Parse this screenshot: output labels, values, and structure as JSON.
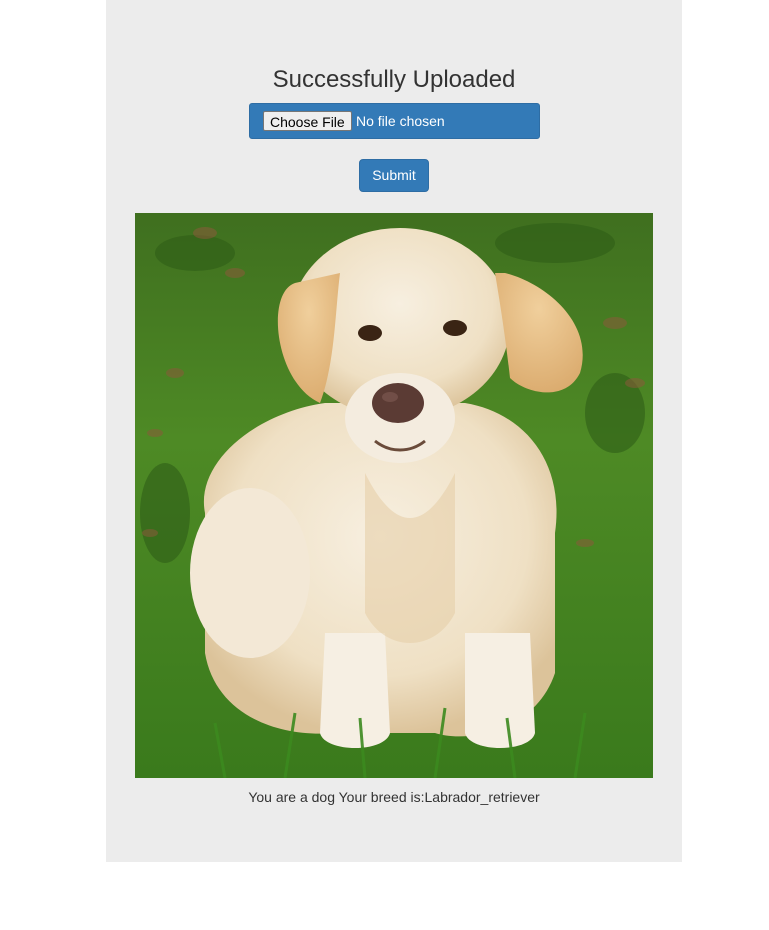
{
  "page": {
    "title": "Successfully Uploaded",
    "upload": {
      "choose_label": "Choose File",
      "status": "No file chosen"
    },
    "submit_label": "Submit",
    "image_subject": "labrador-dog-photo",
    "result_text": "You are a dog Your breed is:Labrador_retriever"
  },
  "colors": {
    "primary": "#337ab7",
    "panel_bg": "#ececec",
    "text": "#333333"
  }
}
